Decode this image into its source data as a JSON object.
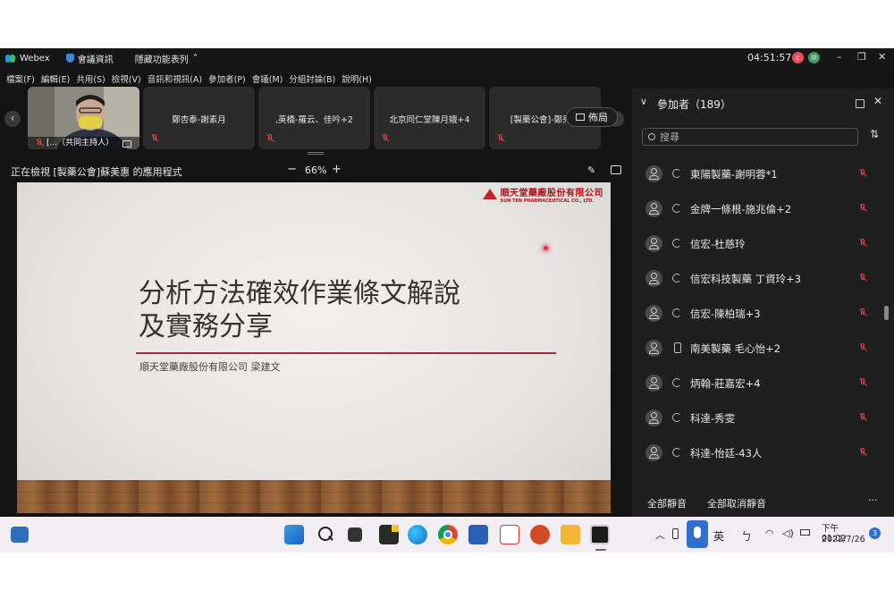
{
  "titlebar": {
    "app_name": "Webex",
    "meeting_info": "會議資訊",
    "hide_menu": "隱藏功能表列",
    "clock": "04:51:57",
    "avatar1": "c",
    "avatar2": "ill",
    "minimize": "–",
    "restore": "❐",
    "close": "✕"
  },
  "menu": [
    "檔案(F)",
    "編輯(E)",
    "共用(S)",
    "檢視(V)",
    "音訊和視訊(A)",
    "參加者(P)",
    "會議(M)",
    "分組討論(B)",
    "說明(H)"
  ],
  "thumbnails": {
    "host_label": "[...（共同主持人）",
    "names": [
      "鄭杏泰-謝素月",
      ",英橋-羅云、佳吟+2",
      "北京同仁堂陳月娥+4",
      "[製藥公會]-鄭秀齡"
    ],
    "layout_button": "佈局"
  },
  "share": {
    "viewing": "正在檢視 [製藥公會]蘇美惠 的應用程式",
    "zoom": "66%",
    "zoom_out": "−",
    "zoom_in": "+"
  },
  "slide": {
    "title": "分析方法確效作業條文解說\n及實務分享",
    "subtitle": "順天堂藥廠股份有限公司  梁建文",
    "company_cn": "順天堂藥廠股份有限公司",
    "company_en": "SUN TEN PHARMACEUTICAL CO., LTD."
  },
  "panel": {
    "title": "參加者（189）",
    "search_placeholder": "搜尋",
    "participants": [
      {
        "name": "東陽製藥-謝明蓉*1",
        "type": "sync"
      },
      {
        "name": "金牌一條根-施兆倫+2",
        "type": "sync"
      },
      {
        "name": "信宏-杜慈玲",
        "type": "sync"
      },
      {
        "name": "信宏科技製藥 丁資玲+3",
        "type": "sync"
      },
      {
        "name": "信宏-陳柏瑞+3",
        "type": "sync"
      },
      {
        "name": "南美製藥 毛心怡+2",
        "type": "phone"
      },
      {
        "name": "炳翰-莊嘉宏+4",
        "type": "sync"
      },
      {
        "name": "科達-秀雯",
        "type": "sync"
      },
      {
        "name": "科達-怡廷-43人",
        "type": "sync"
      }
    ],
    "mute_all": "全部靜音",
    "unmute_all": "全部取消靜音",
    "more": "···"
  },
  "taskbar": {
    "ime_lang": "英",
    "ime_mode": "ㄅ",
    "time": "下午 01:02",
    "date": "2022/7/26",
    "notification_count": "3"
  },
  "colors": {
    "accent_red": "#e04646",
    "rule": "#9b2d3f",
    "brand_red": "#c8202b"
  }
}
